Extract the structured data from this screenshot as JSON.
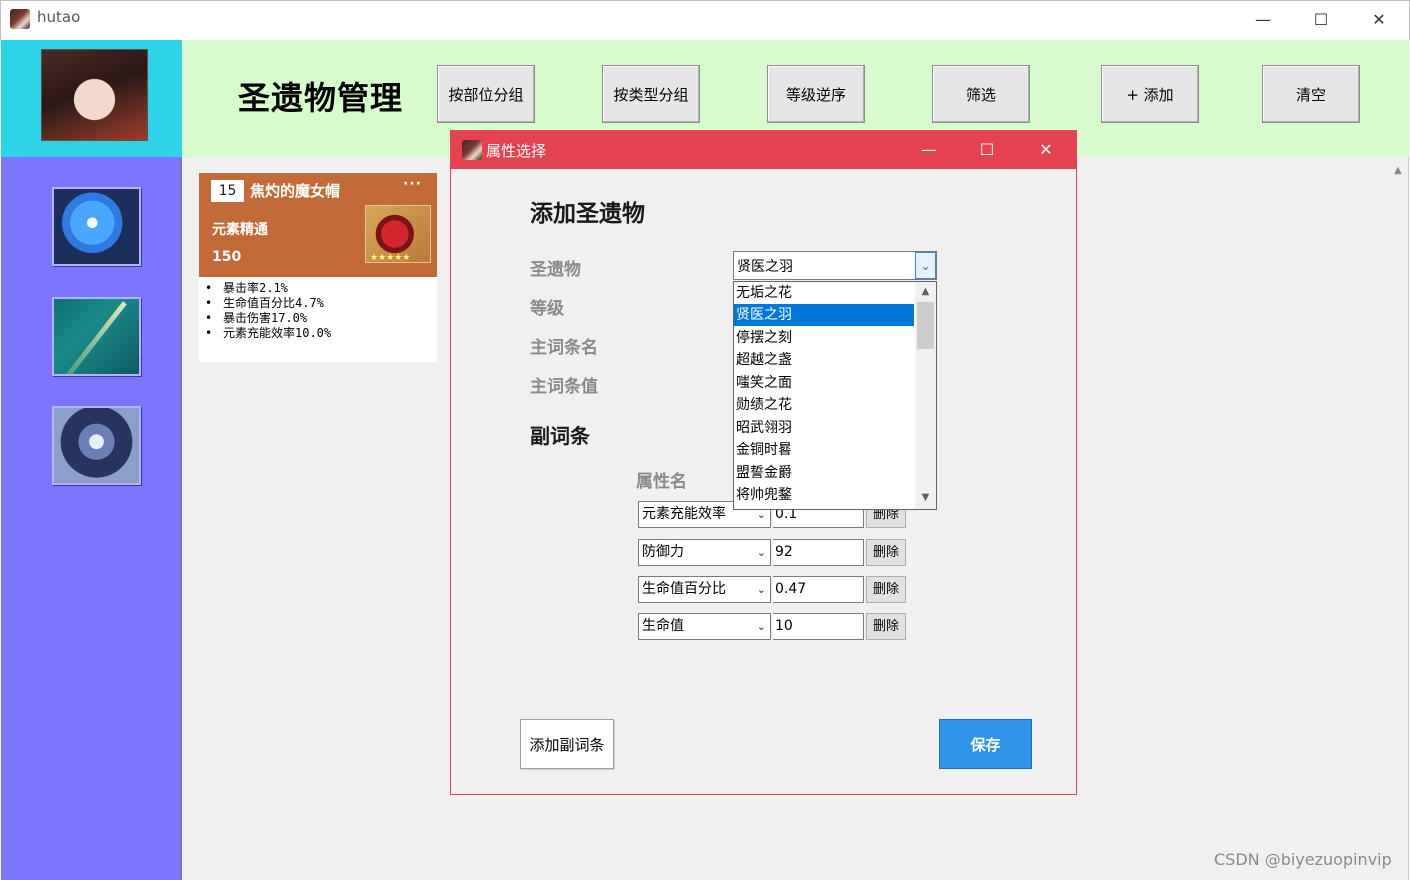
{
  "window": {
    "title": "hutao",
    "minimize": "—",
    "maximize": "☐",
    "close": "✕"
  },
  "header": {
    "title": "圣遗物管理",
    "buttons": [
      {
        "label": "按部位分组"
      },
      {
        "label": "按类型分组"
      },
      {
        "label": "等级逆序"
      },
      {
        "label": "筛选"
      },
      {
        "label": "+ 添加"
      },
      {
        "label": "清空"
      }
    ]
  },
  "sidebar": {
    "icons": [
      "flower-icon",
      "weapon-icon",
      "character-icon"
    ]
  },
  "card": {
    "level": "15",
    "name": "焦灼的魔女帽",
    "more": "···",
    "main_stat": "元素精通",
    "main_value": "150",
    "stars": "★★★★★",
    "sub_stats": [
      "暴击率2.1%",
      "生命值百分比4.7%",
      "暴击伤害17.0%",
      "元素充能效率10.0%"
    ]
  },
  "dialog": {
    "title": "属性选择",
    "heading": "添加圣遗物",
    "labels": {
      "artifact": "圣遗物",
      "level": "等级",
      "main_name": "主词条名",
      "main_value": "主词条值",
      "sub_heading": "副词条",
      "attr_col": "属性名"
    },
    "artifact_select": {
      "value": "贤医之羽",
      "options": [
        "无垢之花",
        "贤医之羽",
        "停摆之刻",
        "超越之盏",
        "嗤笑之面",
        "勋绩之花",
        "昭武翎羽",
        "金铜时晷",
        "盟誓金爵",
        "将帅兜鍪"
      ],
      "selected_index": 1
    },
    "sub_rows": [
      {
        "attr": "元素充能效率",
        "value": "0.1",
        "delete": "删除"
      },
      {
        "attr": "防御力",
        "value": "92",
        "delete": "删除"
      },
      {
        "attr": "生命值百分比",
        "value": "0.47",
        "delete": "删除"
      },
      {
        "attr": "生命值",
        "value": "10",
        "delete": "删除"
      }
    ],
    "add_sub_button": "添加副词条",
    "save_button": "保存"
  },
  "watermark": "CSDN @biyezuopinvip",
  "colors": {
    "header_bg": "#d7fbcd",
    "avatar_bg": "#2dd3e6",
    "sidebar_bg": "#7c76ff",
    "card_accent": "#c26b38",
    "dialog_title_bg": "#e4424e",
    "save_button_bg": "#2e95e8",
    "selection": "#0078d7"
  }
}
